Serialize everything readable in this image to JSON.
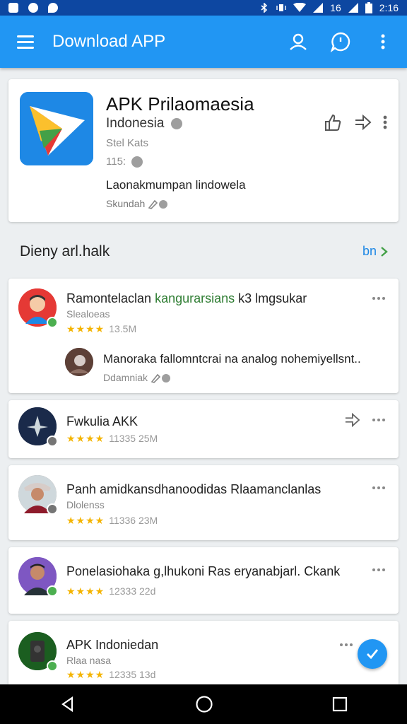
{
  "status_bar": {
    "signal": "16",
    "time": "2:16"
  },
  "app_bar": {
    "title": "Download APP"
  },
  "app": {
    "name": "APK Prilaomaesia",
    "country": "Indonesia",
    "subtitle": "Stel Kats",
    "size": "115:",
    "description": "Laonakmumpan lindowela",
    "meta": "Skundah"
  },
  "section": {
    "title": "Dieny arl.halk",
    "more_label": "bn"
  },
  "reviews": [
    {
      "name": "Ramontelaclan",
      "highlight": "kangurarsians",
      "name_rest": "k3 lmgsukar",
      "sub": "Slealoeas",
      "stars": "★★★★",
      "count": "13.5M",
      "reply": {
        "text": "Manoraka fallomntcrai na analog nohemiyellsnt..",
        "meta": "Ddamniak"
      }
    },
    {
      "name": "Fwkulia AKK",
      "stars": "★★★★",
      "count": "11335 25M"
    },
    {
      "name": "Panh amidkansdhanoodidas Rlaamanclanlas",
      "sub": "Dlolenss",
      "stars": "★★★★",
      "count": "11336 23M"
    },
    {
      "name": "Ponelasiohaka g,lhukoni Ras eryanabjarl. Ckank",
      "stars": "★★★★",
      "count": "12333 22d"
    },
    {
      "name": "APK Indoniedan",
      "sub": "Rlaa nasa",
      "stars": "★★★★",
      "count": "12335 13d"
    }
  ],
  "colors": {
    "accent": "#2196f3",
    "status": "#0d47a1",
    "star": "#f4b400",
    "highlight": "#2e7d32"
  }
}
